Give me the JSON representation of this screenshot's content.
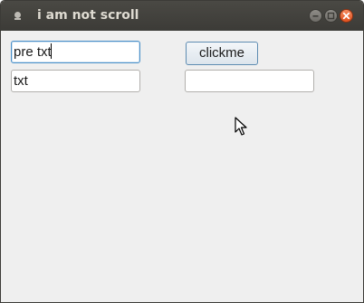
{
  "window": {
    "title": "i am not scroll"
  },
  "titlebar_buttons": {
    "minimize_icon": "minimize-icon",
    "maximize_icon": "maximize-icon",
    "close_icon": "close-icon"
  },
  "form": {
    "field1_value": "pre txt",
    "field2_value": "txt",
    "field3_value": "",
    "button_label": "clickme"
  },
  "colors": {
    "titlebar": "#3c3b37",
    "close_button": "#e95420",
    "focus_border": "#4a90c9",
    "background": "#efefef"
  }
}
